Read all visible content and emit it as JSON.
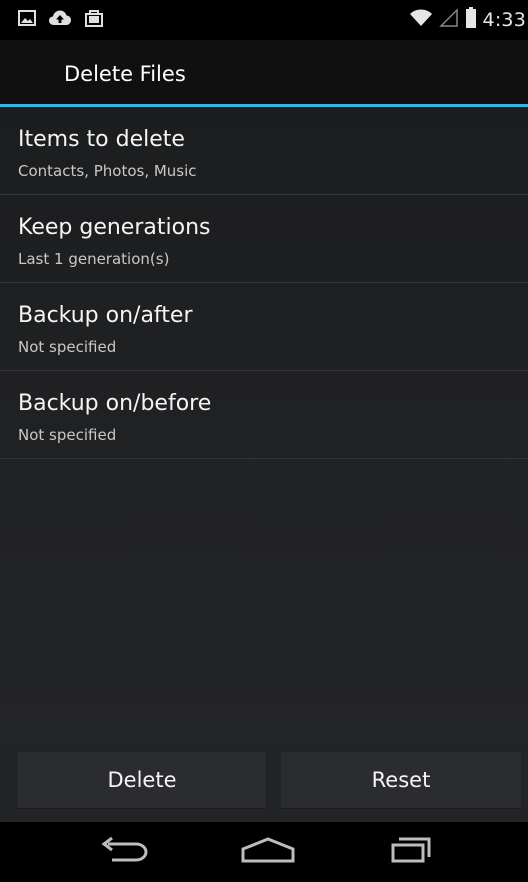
{
  "status_bar": {
    "time": "4:33",
    "icons": [
      "image-icon",
      "cloud-upload-icon",
      "bag-icon",
      "wifi-icon",
      "signal-icon",
      "battery-icon"
    ]
  },
  "action_bar": {
    "title": "Delete Files",
    "accent_color": "#33b5e5"
  },
  "settings": [
    {
      "title": "Items to delete",
      "summary": "Contacts, Photos, Music"
    },
    {
      "title": "Keep generations",
      "summary": "Last 1 generation(s)"
    },
    {
      "title": "Backup on/after",
      "summary": "Not specified"
    },
    {
      "title": "Backup on/before",
      "summary": "Not specified"
    }
  ],
  "buttons": {
    "delete_label": "Delete",
    "reset_label": "Reset"
  },
  "nav_bar": {
    "icons": [
      "back-icon",
      "home-icon",
      "recent-apps-icon"
    ]
  }
}
